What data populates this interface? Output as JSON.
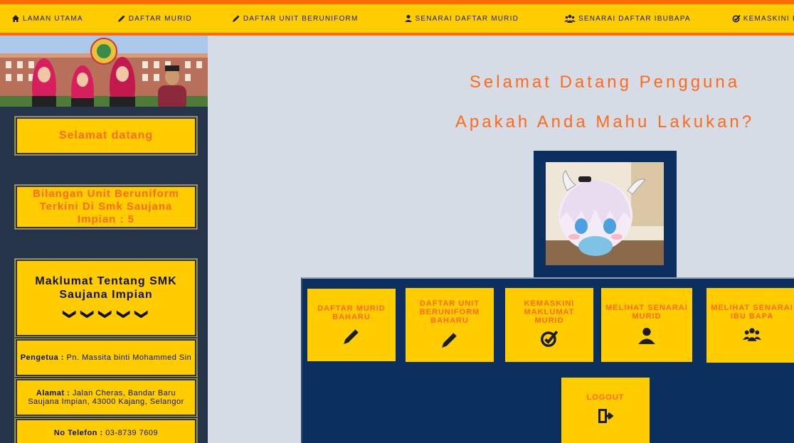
{
  "nav": {
    "items": [
      {
        "label": "LAMAN UTAMA",
        "icon": "home-icon"
      },
      {
        "label": "DAFTAR MURID",
        "icon": "pencil-icon"
      },
      {
        "label": "DAFTAR UNIT BERUNIFORM",
        "icon": "pencil-icon"
      },
      {
        "label": "SENARAI DAFTAR MURID",
        "icon": "user-icon"
      },
      {
        "label": "SENARAI DAFTAR IBUBAPA",
        "icon": "group-icon"
      },
      {
        "label": "KEMASKINI DATA",
        "icon": "edit-check-icon"
      }
    ]
  },
  "sidebar": {
    "welcome": "Selamat datang",
    "unit_count": "Bilangan Unit Beruniform Terkini Di Smk Saujana Impian : 5",
    "info_title": "Maklumat Tentang SMK Saujana Impian",
    "chevrons": "❯❯❯❯❯",
    "principal_label": "Pengetua :",
    "principal_value": "Pn. Massita binti Mohammed Sin",
    "address_label": "Alamat :",
    "address_value": "Jalan Cheras, Bandar Baru Saujana Impian, 43000 Kajang, Selangor",
    "phone_label": "No Telefon :",
    "phone_value": "03-8739 7609"
  },
  "main": {
    "greeting": "Selamat Datang Pengguna",
    "question": "Apakah Anda Mahu Lakukan?",
    "actions": [
      {
        "label": "DAFTAR MURID BAHARU",
        "icon": "pencil-icon"
      },
      {
        "label": "DAFTAR UNIT BERUNIFORM BAHARU",
        "icon": "pencil-icon"
      },
      {
        "label": "KEMASKINI MAKLUMAT MURID",
        "icon": "edit-check-icon"
      },
      {
        "label": "MELIHAT SENARAI MURID",
        "icon": "user-icon"
      },
      {
        "label": "MELIHAT SENARAI IBU BAPA",
        "icon": "group-icon"
      },
      {
        "label": "LOGOUT",
        "icon": "logout-icon"
      }
    ]
  },
  "colors": {
    "accent": "#ffcc00",
    "text_accent": "#ff6a1a",
    "navy": "#0b2f5e",
    "sidebar": "#26344a"
  }
}
